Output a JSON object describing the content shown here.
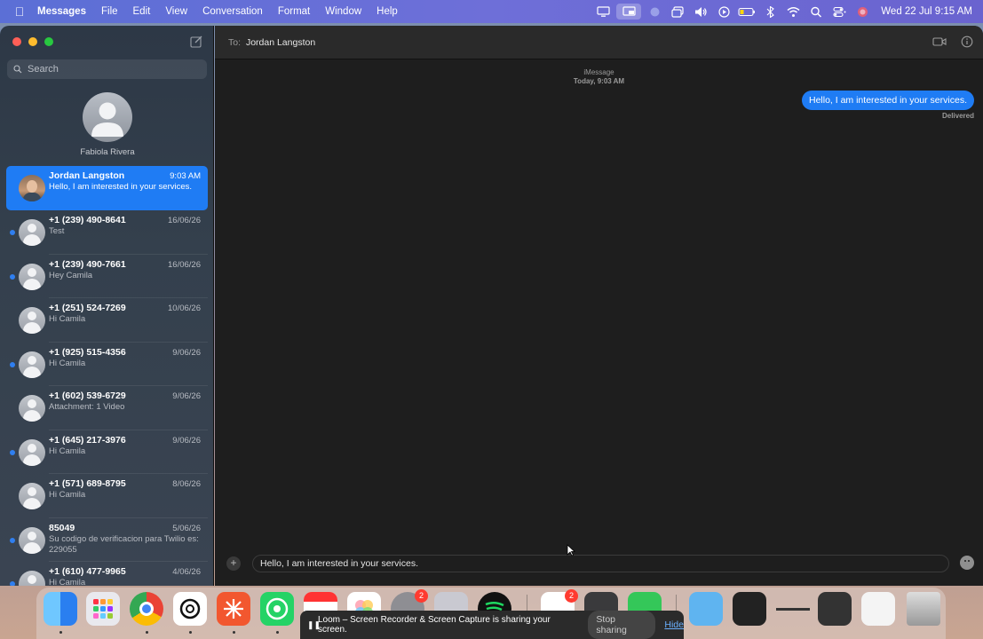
{
  "menubar": {
    "app": "Messages",
    "items": [
      "File",
      "Edit",
      "View",
      "Conversation",
      "Format",
      "Window",
      "Help"
    ],
    "status_icons": [
      "display-icon",
      "screen-share-icon",
      "focus-icon",
      "window-icon",
      "volume-icon",
      "play-icon",
      "battery-icon",
      "bluetooth-icon",
      "wifi-icon",
      "search-icon",
      "control-center-icon",
      "siri-icon"
    ],
    "clock": "Wed 22 Jul  9:15 AM"
  },
  "sidebar": {
    "search_placeholder": "Search",
    "pinned": {
      "name": "Fabiola Rivera"
    },
    "conversations": [
      {
        "title": "Jordan Langston",
        "date": "9:03 AM",
        "preview": "Hello, I am interested in your services.",
        "selected": true,
        "unread": false,
        "photo": true
      },
      {
        "title": "+1 (239) 490-8641",
        "date": "16/06/26",
        "preview": "Test",
        "unread": true
      },
      {
        "title": "+1 (239) 490-7661",
        "date": "16/06/26",
        "preview": "Hey Camila",
        "unread": true
      },
      {
        "title": "+1 (251) 524-7269",
        "date": "10/06/26",
        "preview": "Hi Camila",
        "unread": false
      },
      {
        "title": "+1 (925) 515-4356",
        "date": "9/06/26",
        "preview": "Hi Camila",
        "unread": true
      },
      {
        "title": "+1 (602) 539-6729",
        "date": "9/06/26",
        "preview": "Attachment: 1 Video",
        "unread": false
      },
      {
        "title": "+1 (645) 217-3976",
        "date": "9/06/26",
        "preview": "Hi Camila",
        "unread": true
      },
      {
        "title": "+1 (571) 689-8795",
        "date": "8/06/26",
        "preview": "Hi Camila",
        "unread": false
      },
      {
        "title": "85049",
        "date": "5/06/26",
        "preview": "Su codigo de verificacion para Twilio es: 229055",
        "unread": true
      },
      {
        "title": "+1 (610) 477-9965",
        "date": "4/06/26",
        "preview": "Hi Camila",
        "unread": true
      }
    ]
  },
  "chat": {
    "to_label": "To:",
    "recipient": "Jordan Langston",
    "service": "iMessage",
    "timestamp": "Today, 9:03 AM",
    "message": "Hello, I am interested in your services.",
    "status": "Delivered",
    "input_value": "Hello, I am interested in your services."
  },
  "dock": {
    "badge_settings": "2",
    "badge_slack": "2"
  },
  "loom": {
    "message": "Loom – Screen Recorder & Screen Capture is sharing your screen.",
    "stop_label": "Stop sharing",
    "hide_label": "Hide"
  },
  "colors": {
    "accent": "#1f7cf4",
    "sidebar_bg": "#34404d",
    "main_bg": "#1e1e1e"
  }
}
